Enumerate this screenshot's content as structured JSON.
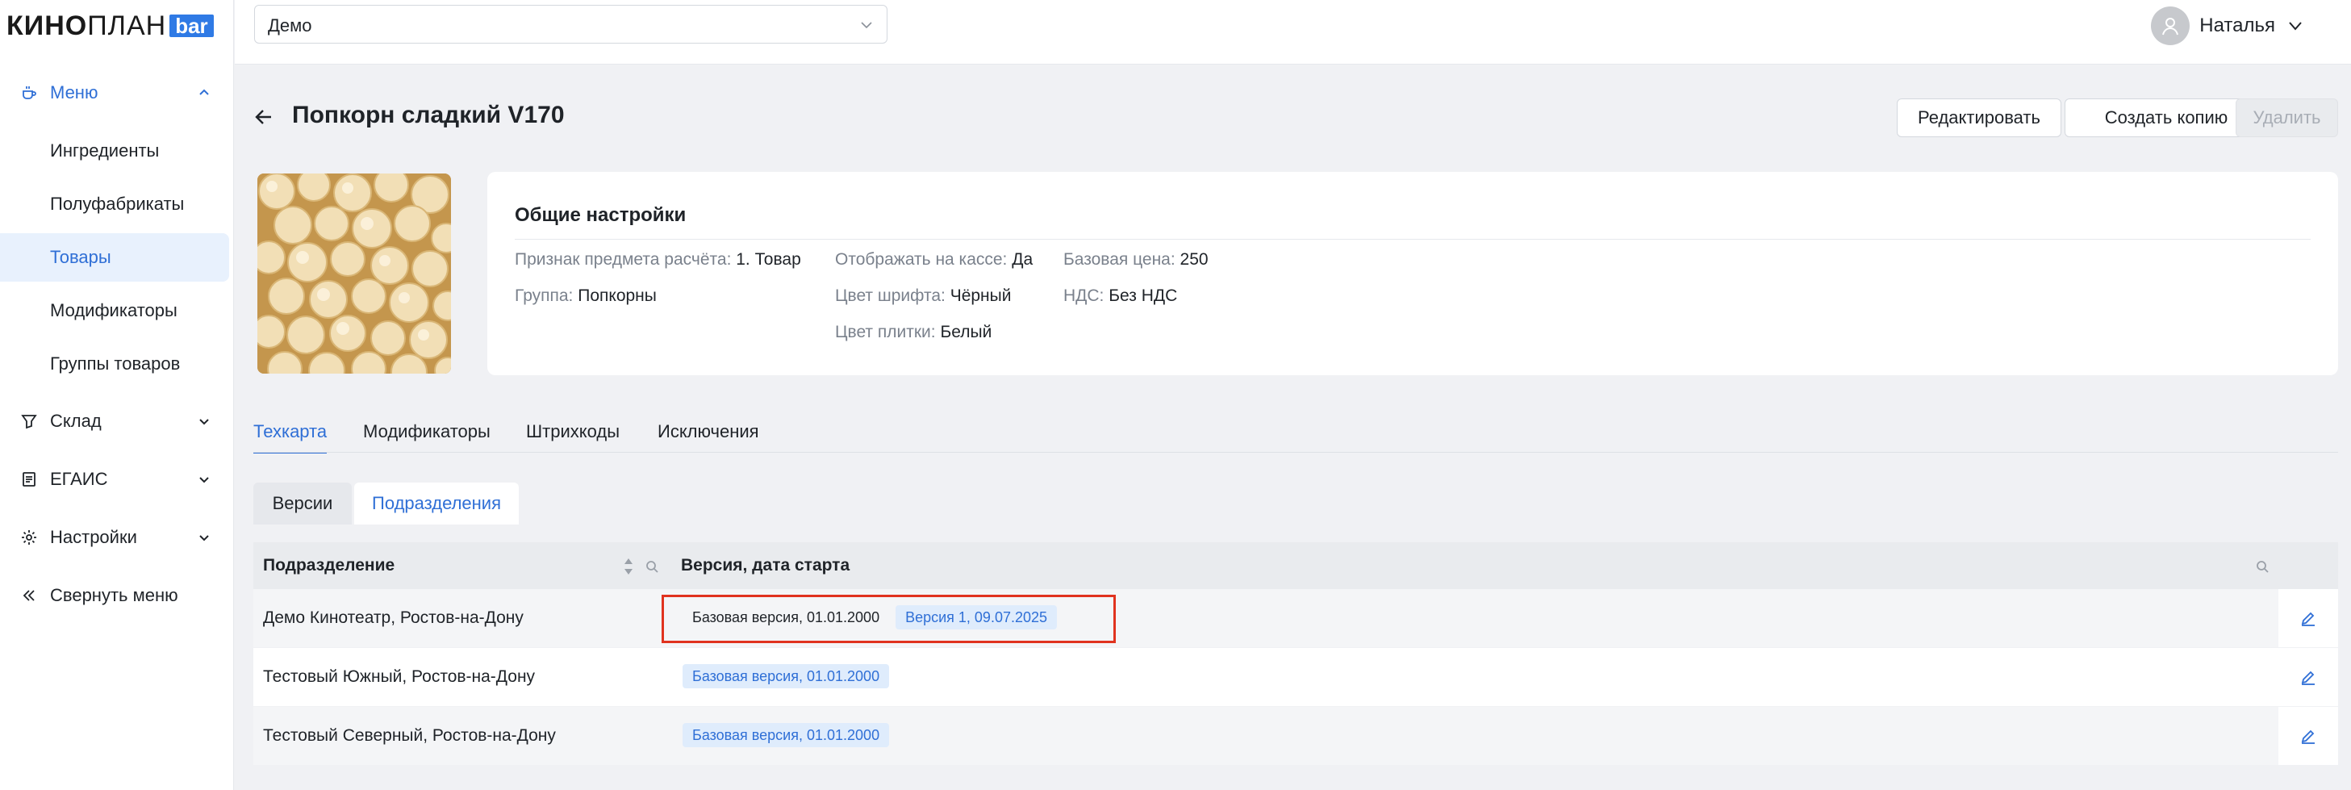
{
  "logo": {
    "word_bold": "КИНО",
    "word_thin": "ПЛАН",
    "badge": "bar"
  },
  "sidebar": {
    "menu": {
      "label": "Меню",
      "icon": "coffee-cup-icon"
    },
    "sub_items": [
      {
        "label": "Ингредиенты"
      },
      {
        "label": "Полуфабрикаты"
      },
      {
        "label": "Товары"
      },
      {
        "label": "Модификаторы"
      },
      {
        "label": "Группы товаров"
      }
    ],
    "warehouse": {
      "label": "Склад",
      "icon": "funnel-glass-icon"
    },
    "egais": {
      "label": "ЕГАИС",
      "icon": "document-icon"
    },
    "settings": {
      "label": "Настройки",
      "icon": "gear-icon"
    },
    "collapse": {
      "label": "Свернуть меню",
      "icon": "double-chevron-left-icon"
    }
  },
  "topbar": {
    "cinema_select": "Демо",
    "user_name": "Наталья"
  },
  "header": {
    "title": "Попкорн сладкий V170",
    "edit_label": "Редактировать",
    "copy_label": "Создать копию",
    "delete_label": "Удалить"
  },
  "general": {
    "title": "Общие настройки",
    "fields": {
      "subject_k": "Признак предмета расчёта:",
      "subject_v": "1. Товар",
      "group_k": "Группа:",
      "group_v": "Попкорны",
      "cashbox_k": "Отображать на кассе:",
      "cashbox_v": "Да",
      "font_k": "Цвет шрифта:",
      "font_v": "Чёрный",
      "tile_k": "Цвет плитки:",
      "tile_v": "Белый",
      "price_k": "Базовая цена:",
      "price_v": "250",
      "vat_k": "НДС:",
      "vat_v": "Без НДС"
    }
  },
  "tabs": [
    {
      "label": "Техкарта"
    },
    {
      "label": "Модификаторы"
    },
    {
      "label": "Штрихкоды"
    },
    {
      "label": "Исключения"
    }
  ],
  "segments": [
    {
      "label": "Версии"
    },
    {
      "label": "Подразделения"
    }
  ],
  "table": {
    "col_division": "Подразделение",
    "col_version": "Версия, дата старта",
    "rows": [
      {
        "division": "Демо Кинотеатр, Ростов-на-Дону",
        "chips": [
          "Базовая версия, 01.01.2000",
          "Версия 1, 09.07.2025"
        ]
      },
      {
        "division": "Тестовый Южный, Ростов-на-Дону",
        "chips": [
          "Базовая версия, 01.01.2000"
        ]
      },
      {
        "division": "Тестовый Северный, Ростов-на-Дону",
        "chips": [
          "Базовая версия, 01.01.2000"
        ]
      }
    ]
  },
  "colors": {
    "accent": "#2f6fd6",
    "highlight": "#e0331f"
  }
}
